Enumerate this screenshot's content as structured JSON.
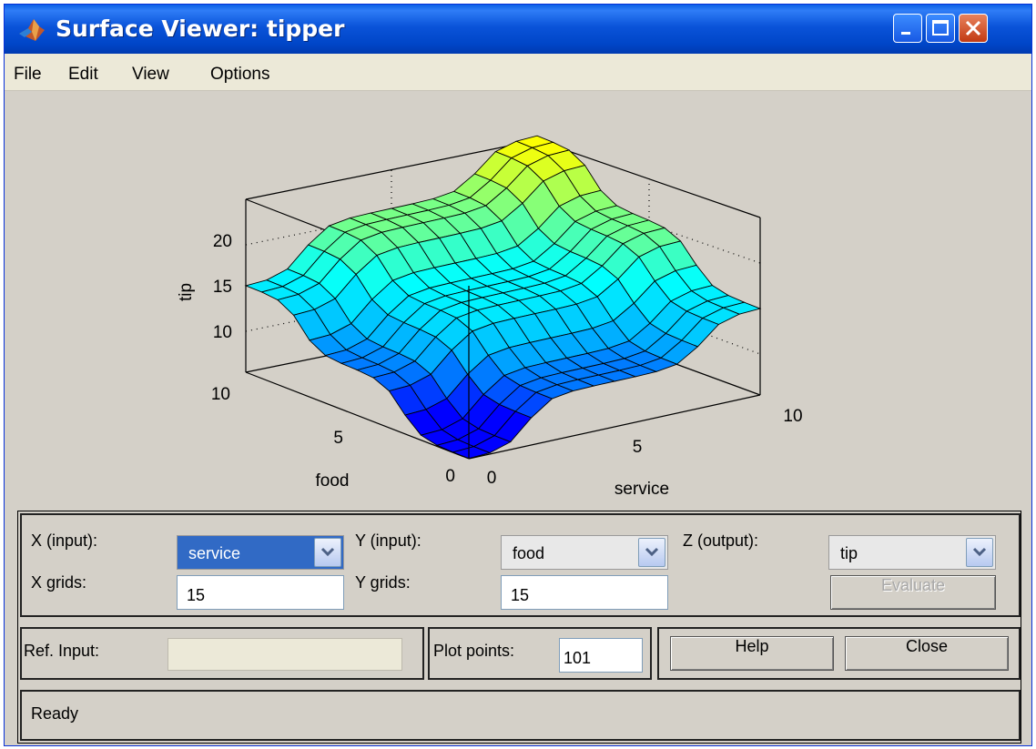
{
  "window": {
    "title": "Surface Viewer: tipper",
    "minimize_icon": "minimize-icon",
    "maximize_icon": "maximize-icon",
    "close_icon": "close-icon"
  },
  "menu": [
    "File",
    "Edit",
    "View",
    "Options"
  ],
  "plot": {
    "zlabel": "tip",
    "ylabel": "food",
    "xlabel": "service",
    "z_ticks": [
      "10",
      "15",
      "20"
    ],
    "y_ticks": [
      "0",
      "5",
      "10"
    ],
    "x_ticks": [
      "0",
      "5",
      "10"
    ],
    "colormap": [
      "#0000ff",
      "#00aaff",
      "#00ffff",
      "#7fff7f",
      "#ffff00"
    ]
  },
  "chart_data": {
    "type": "surface",
    "title": "",
    "xlabel": "service",
    "ylabel": "food",
    "zlabel": "tip",
    "xlim": [
      0,
      10
    ],
    "ylim": [
      0,
      10
    ],
    "zlim": [
      5,
      25
    ],
    "x_grids": 15,
    "y_grids": 15,
    "z_min_approx": 5,
    "z_max_approx": 25
  },
  "controls": {
    "x_input_label": "X (input):",
    "x_input_value": "service",
    "y_input_label": "Y (input):",
    "y_input_value": "food",
    "z_output_label": "Z (output):",
    "z_output_value": "tip",
    "x_grids_label": "X grids:",
    "x_grids_value": "15",
    "y_grids_label": "Y grids:",
    "y_grids_value": "15",
    "evaluate_label": "Evaluate",
    "ref_input_label": "Ref. Input:",
    "ref_input_value": "",
    "plot_points_label": "Plot points:",
    "plot_points_value": "101",
    "help_label": "Help",
    "close_label": "Close",
    "status": "Ready"
  }
}
